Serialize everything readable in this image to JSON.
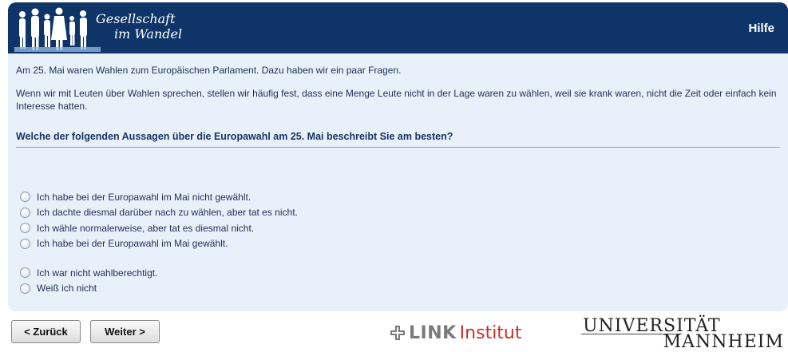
{
  "header": {
    "logo_line1": "Gesellschaft",
    "logo_line2": "im Wandel",
    "help_label": "Hilfe"
  },
  "intro": {
    "paragraph1": "Am 25. Mai waren Wahlen zum Europäischen Parlament. Dazu haben wir ein paar Fragen.",
    "paragraph2": "Wenn wir mit Leuten über Wahlen sprechen, stellen wir häufig fest, dass eine Menge Leute nicht in der Lage waren zu wählen, weil sie krank waren, nicht die Zeit oder einfach kein Interesse hatten."
  },
  "question": {
    "text": "Welche der folgenden Aussagen über die Europawahl am 25. Mai beschreibt Sie am besten?",
    "options": [
      "Ich habe bei der Europawahl im Mai nicht gewählt.",
      "Ich dachte diesmal darüber nach zu wählen, aber tat es nicht.",
      "Ich wähle normalerweise, aber tat es diesmal nicht.",
      "Ich habe bei der Europawahl im Mai gewählt.",
      "Ich war nicht wahlberechtigt.",
      "Weiß ich nicht"
    ]
  },
  "nav": {
    "back_label": "< Zurück",
    "next_label": "Weiter >"
  },
  "footer": {
    "link_word": "LINK",
    "link_institut": "Institut",
    "uni_line1": "UNIVERSITÄT",
    "uni_line2": "MANNHEIM"
  },
  "colors": {
    "header_bg": "#0f3467",
    "content_bg": "#e8f0fa",
    "link_red": "#c8302e"
  }
}
